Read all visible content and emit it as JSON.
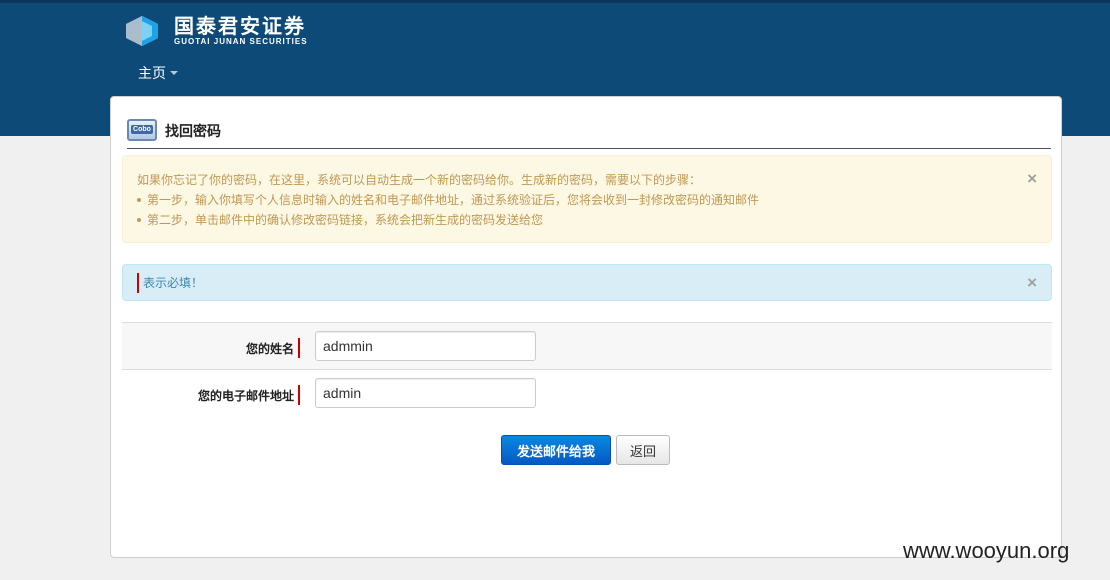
{
  "brand": {
    "name_cn": "国泰君安证券",
    "name_en": "GUOTAI JUNAN SECURITIES"
  },
  "nav": {
    "home_label": "主页"
  },
  "panel": {
    "title": "找回密码"
  },
  "notice": {
    "intro": "如果你忘记了你的密码，在这里，系统可以自动生成一个新的密码给你。生成新的密码，需要以下的步骤：",
    "steps": [
      "第一步，输入你填写个人信息时输入的姓名和电子邮件地址，通过系统验证后，您将会收到一封修改密码的通知邮件",
      "第二步，单击邮件中的确认修改密码链接，系统会把新生成的密码发送给您"
    ],
    "close": "×"
  },
  "required_notice": {
    "text": "表示必填！",
    "close": "×"
  },
  "form": {
    "name_label": "您的姓名",
    "name_value": "admmin",
    "email_label": "您的电子邮件地址",
    "email_value": "admin"
  },
  "buttons": {
    "submit": "发送邮件给我",
    "back": "返回"
  },
  "watermark": "www.wooyun.org",
  "colors": {
    "header_bg": "#0e4a78",
    "primary_button": "#0459c4",
    "warning_bg": "#fcf8e3",
    "info_bg": "#d9edf7",
    "required_marker": "#cc0000"
  }
}
